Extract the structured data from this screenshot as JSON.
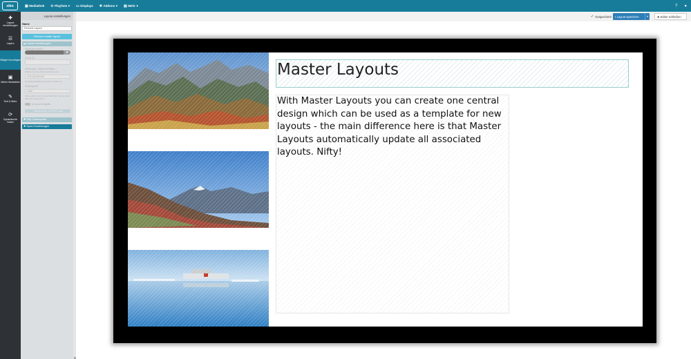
{
  "app": {
    "logo": "xibo"
  },
  "nav": {
    "items": [
      {
        "label": "Mediathek",
        "icon": "media-icon"
      },
      {
        "label": "Playlists",
        "icon": "playlist-icon",
        "caret": "▾"
      },
      {
        "label": "Displays",
        "icon": "display-icon"
      },
      {
        "label": "Addons",
        "icon": "addons-icon",
        "caret": "▾"
      },
      {
        "label": "Mehr",
        "icon": "more-icon",
        "caret": "▾"
      }
    ]
  },
  "sidebar": {
    "items": [
      {
        "label": "Layout einstellungen",
        "icon": "puzzle-icon"
      },
      {
        "label": "Layers",
        "icon": "layers-icon"
      },
      {
        "label": "Widget hinzufügen",
        "icon": "",
        "active": true
      },
      {
        "label": "Meine Mediathek",
        "icon": "image-icon"
      },
      {
        "label": "Text & Mehr",
        "icon": "pen-icon"
      },
      {
        "label": "Dynamische Daten",
        "icon": "sync-icon"
      }
    ]
  },
  "panel": {
    "header": "Layout einstellungen",
    "name_label": "Name",
    "name_value": "Derived Layout",
    "remove_button": "Remove master layout",
    "section_layout": "Layout einstellungen",
    "bg_color_label": "Hintergrundfarbe",
    "clear_symbol": "✖",
    "cover_label": "Cover ID",
    "resolution_label": "Auflösung / Seitenverhältnis",
    "resolution_hint": "Wählen Sie das Seitenverhältnis aus.",
    "resolution_value": "16:9 Querformat",
    "resolution_hint2": "16:9(1920x1080) gewünschte Auflösung",
    "grid_label": "Rastergröße",
    "grid_value": "small",
    "grid_hint": "Was machen Sie mit dem Wert hier? gerne daher Hilfe bei Unterschied",
    "template_toggle": "is layout template",
    "css_button": "Benutzerdef. CSS/JS Code",
    "section_data": "XML Datenquelle",
    "section_save": "Speir-Einstellungen"
  },
  "toolbar": {
    "saved": "Gespeichert!",
    "save_label": "Layout speichern",
    "close_label": "Editor schließen"
  },
  "canvas": {
    "title": "Master Layouts",
    "body": "With Master Layouts you can create one central design which can be used as a template for new layouts - the main difference here is that Master Layouts automatically update all associated layouts. Nifty!"
  }
}
